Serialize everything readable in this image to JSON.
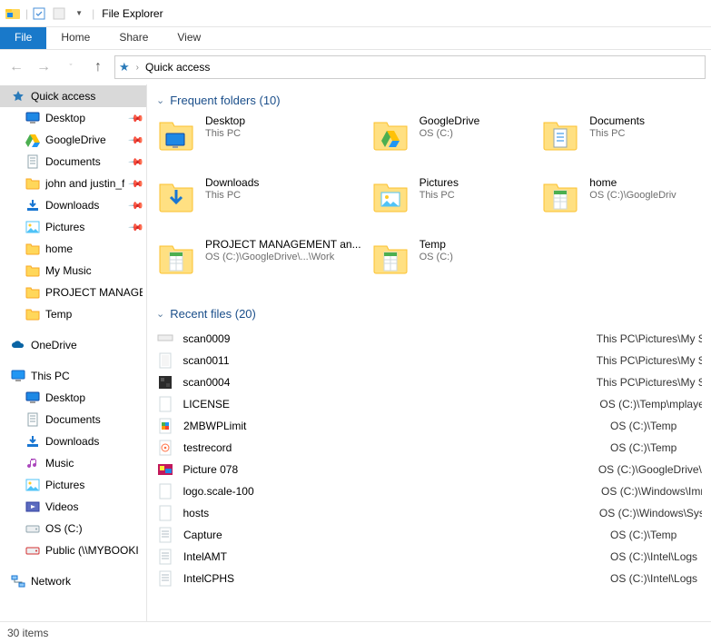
{
  "titlebar": {
    "title": "File Explorer"
  },
  "ribbon": {
    "file": "File",
    "home": "Home",
    "share": "Share",
    "view": "View"
  },
  "address": {
    "location": "Quick access"
  },
  "sidebar": {
    "quick_access": "Quick access",
    "items": [
      {
        "label": "Desktop",
        "icon": "desktop",
        "pinned": true
      },
      {
        "label": "GoogleDrive",
        "icon": "gdrive",
        "pinned": true
      },
      {
        "label": "Documents",
        "icon": "documents",
        "pinned": true
      },
      {
        "label": "john and justin_f",
        "icon": "folder",
        "pinned": true
      },
      {
        "label": "Downloads",
        "icon": "downloads",
        "pinned": true
      },
      {
        "label": "Pictures",
        "icon": "pictures",
        "pinned": true
      },
      {
        "label": "home",
        "icon": "folder",
        "pinned": false
      },
      {
        "label": "My Music",
        "icon": "folder",
        "pinned": false
      },
      {
        "label": "PROJECT MANAGEI",
        "icon": "folder",
        "pinned": false
      },
      {
        "label": "Temp",
        "icon": "folder",
        "pinned": false
      }
    ],
    "onedrive": "OneDrive",
    "thispc": "This PC",
    "pc_items": [
      {
        "label": "Desktop",
        "icon": "desktop"
      },
      {
        "label": "Documents",
        "icon": "documents"
      },
      {
        "label": "Downloads",
        "icon": "downloads"
      },
      {
        "label": "Music",
        "icon": "music"
      },
      {
        "label": "Pictures",
        "icon": "pictures"
      },
      {
        "label": "Videos",
        "icon": "videos"
      },
      {
        "label": "OS (C:)",
        "icon": "drive"
      },
      {
        "label": "Public (\\\\MYBOOKI",
        "icon": "netdrive"
      }
    ],
    "network": "Network"
  },
  "sections": {
    "frequent": {
      "title": "Frequent folders (10)"
    },
    "recent": {
      "title": "Recent files (20)"
    }
  },
  "folders": [
    {
      "name": "Desktop",
      "loc": "This PC",
      "icon": "desktop-folder",
      "pinned": true
    },
    {
      "name": "GoogleDrive",
      "loc": "OS (C:)",
      "icon": "gdrive-folder",
      "pinned": true
    },
    {
      "name": "Documents",
      "loc": "This PC",
      "icon": "documents-folder",
      "pinned": true
    },
    {
      "name": "Downloads",
      "loc": "This PC",
      "icon": "downloads-folder",
      "pinned": true
    },
    {
      "name": "Pictures",
      "loc": "This PC",
      "icon": "pictures-folder",
      "pinned": true
    },
    {
      "name": "home",
      "loc": "OS (C:)\\GoogleDriv",
      "icon": "sheet-folder",
      "pinned": false
    },
    {
      "name": "PROJECT MANAGEMENT an...",
      "loc": "OS (C:)\\GoogleDrive\\...\\Work",
      "icon": "sheet-folder",
      "pinned": false
    },
    {
      "name": "Temp",
      "loc": "OS (C:)",
      "icon": "sheet-folder",
      "pinned": false
    }
  ],
  "recent": [
    {
      "name": "scan0009",
      "loc": "This PC\\Pictures\\My S",
      "icon": "img-wide"
    },
    {
      "name": "scan0011",
      "loc": "This PC\\Pictures\\My S",
      "icon": "img-page"
    },
    {
      "name": "scan0004",
      "loc": "This PC\\Pictures\\My S",
      "icon": "img-dark"
    },
    {
      "name": "LICENSE",
      "loc": "OS (C:)\\Temp\\mplaye",
      "icon": "blank"
    },
    {
      "name": "2MBWPLimit",
      "loc": "OS (C:)\\Temp",
      "icon": "reg"
    },
    {
      "name": "testrecord",
      "loc": "OS (C:)\\Temp",
      "icon": "audio"
    },
    {
      "name": "Picture 078",
      "loc": "OS (C:)\\GoogleDrive\\I",
      "icon": "img-color"
    },
    {
      "name": "logo.scale-100",
      "loc": "OS (C:)\\Windows\\Imr",
      "icon": "blank"
    },
    {
      "name": "hosts",
      "loc": "OS (C:)\\Windows\\Sys",
      "icon": "blank"
    },
    {
      "name": "Capture",
      "loc": "OS (C:)\\Temp",
      "icon": "text"
    },
    {
      "name": "IntelAMT",
      "loc": "OS (C:)\\Intel\\Logs",
      "icon": "text"
    },
    {
      "name": "IntelCPHS",
      "loc": "OS (C:)\\Intel\\Logs",
      "icon": "text"
    }
  ],
  "status": {
    "items": "30 items"
  }
}
